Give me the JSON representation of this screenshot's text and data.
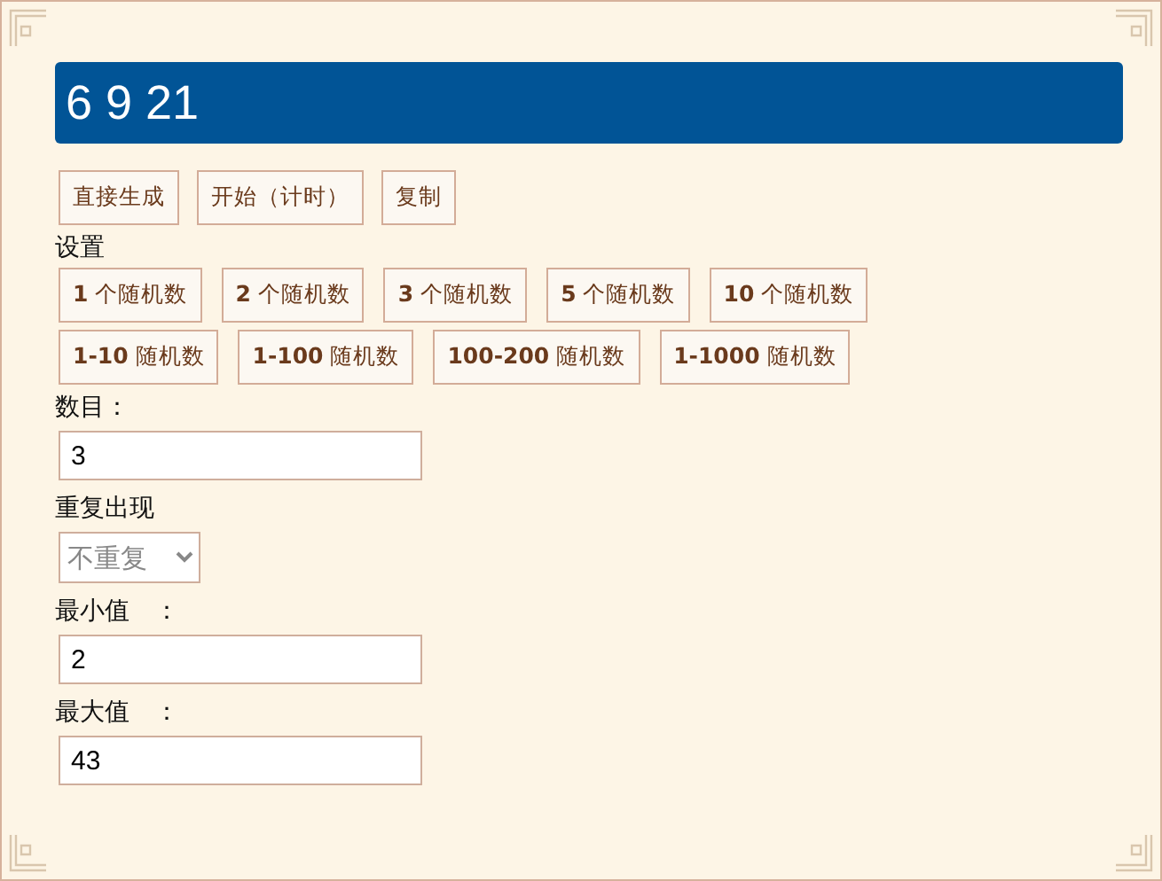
{
  "result": {
    "text": "6 9 21"
  },
  "actions": [
    "直接生成",
    "开始（计时）",
    "复制"
  ],
  "settings": {
    "title": "设置",
    "presets": [
      [
        "**1** 个随机数",
        "**2** 个随机数",
        "**3** 个随机数",
        "**5** 个随机数",
        "**10** 个随机数"
      ],
      [
        "**1-10** 随机数",
        "**1-100** 随机数",
        "**100-200** 随机数",
        "**1-1000** 随机数"
      ]
    ]
  },
  "fields": [
    {
      "kind": "input",
      "label": "数目：",
      "value": "3"
    },
    {
      "kind": "select",
      "label": "重复出现",
      "value": "不重复"
    },
    {
      "kind": "input",
      "label": "最小值　：",
      "value": "2"
    },
    {
      "kind": "input",
      "label": "最大值　：",
      "value": "43"
    }
  ]
}
